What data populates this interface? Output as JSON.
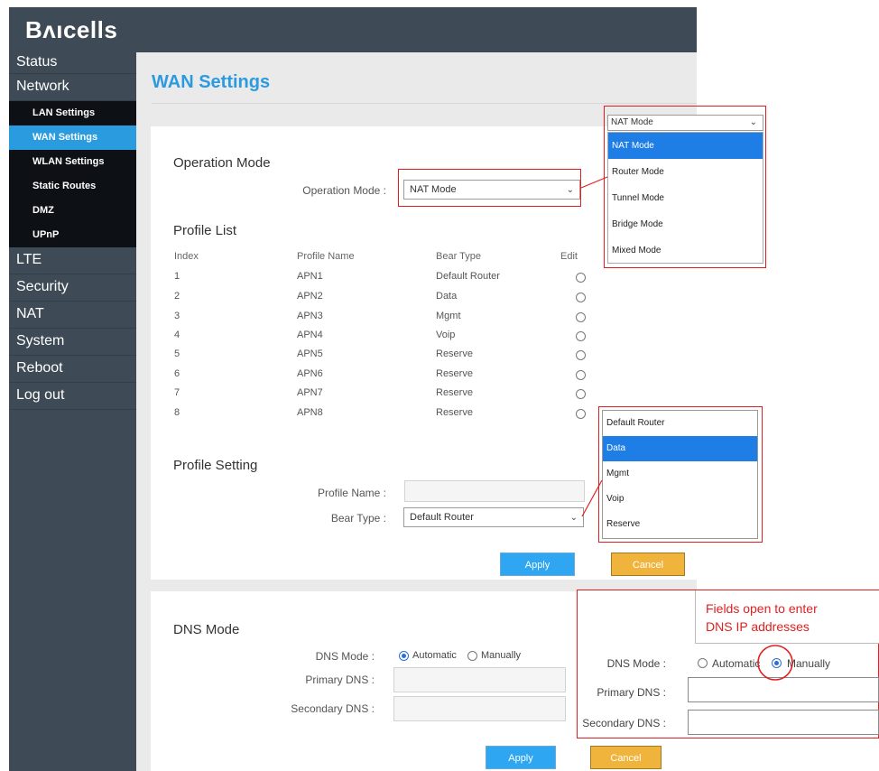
{
  "brand": "Bᴧıcells",
  "sidebar": {
    "items": [
      {
        "label": "Status"
      },
      {
        "label": "Network"
      },
      {
        "label": "LTE"
      },
      {
        "label": "Security"
      },
      {
        "label": "NAT"
      },
      {
        "label": "System"
      },
      {
        "label": "Reboot"
      },
      {
        "label": "Log out"
      }
    ],
    "subitems": [
      {
        "label": "LAN Settings"
      },
      {
        "label": "WAN Settings",
        "active": true
      },
      {
        "label": "WLAN Settings"
      },
      {
        "label": "Static Routes"
      },
      {
        "label": "DMZ"
      },
      {
        "label": "UPnP"
      }
    ]
  },
  "page": {
    "title": "WAN Settings"
  },
  "operation_mode": {
    "section_title": "Operation Mode",
    "label": "Operation Mode :",
    "value": "NAT Mode",
    "dropdown": {
      "selected_header": "NAT Mode",
      "options": [
        "NAT Mode",
        "Router Mode",
        "Tunnel Mode",
        "Bridge Mode",
        "Mixed Mode"
      ],
      "highlighted": "NAT Mode"
    }
  },
  "profile_list": {
    "section_title": "Profile List",
    "headers": {
      "index": "Index",
      "name": "Profile Name",
      "bear": "Bear Type",
      "edit": "Edit"
    },
    "rows": [
      {
        "index": "1",
        "name": "APN1",
        "bear": "Default Router"
      },
      {
        "index": "2",
        "name": "APN2",
        "bear": "Data"
      },
      {
        "index": "3",
        "name": "APN3",
        "bear": "Mgmt"
      },
      {
        "index": "4",
        "name": "APN4",
        "bear": "Voip"
      },
      {
        "index": "5",
        "name": "APN5",
        "bear": "Reserve"
      },
      {
        "index": "6",
        "name": "APN6",
        "bear": "Reserve"
      },
      {
        "index": "7",
        "name": "APN7",
        "bear": "Reserve"
      },
      {
        "index": "8",
        "name": "APN8",
        "bear": "Reserve"
      }
    ]
  },
  "profile_setting": {
    "section_title": "Profile Setting",
    "name_label": "Profile Name :",
    "name_value": "",
    "bear_label": "Bear Type :",
    "bear_value": "Default Router",
    "dropdown": {
      "options": [
        "Default Router",
        "Data",
        "Mgmt",
        "Voip",
        "Reserve"
      ],
      "highlighted": "Data"
    },
    "apply": "Apply",
    "cancel": "Cancel"
  },
  "dns": {
    "section_title": "DNS Mode",
    "mode_label": "DNS Mode :",
    "opt_auto": "Automatic",
    "opt_manual": "Manually",
    "selected": "Automatic",
    "primary_label": "Primary DNS :",
    "secondary_label": "Secondary DNS :",
    "apply": "Apply",
    "cancel": "Cancel"
  },
  "callout": {
    "line1": "Fields open to enter",
    "line2": "DNS IP addresses",
    "mode_label": "DNS Mode :",
    "opt_auto": "Automatic",
    "opt_manual": "Manually",
    "selected": "Manually",
    "primary_label": "Primary DNS :",
    "secondary_label": "Secondary DNS :"
  },
  "colors": {
    "accent": "#2b9be0",
    "sidebar": "#3e4a55",
    "annotation": "#e02020",
    "cancel": "#f0b43c"
  }
}
